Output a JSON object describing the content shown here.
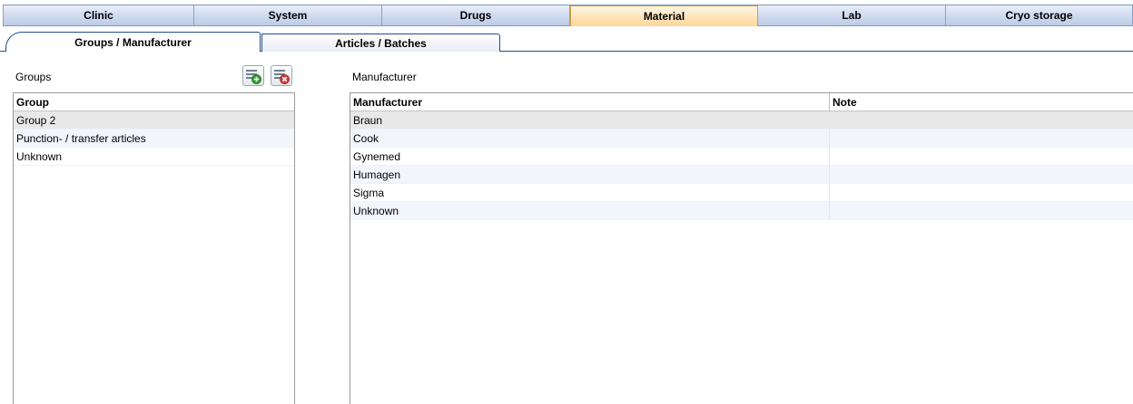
{
  "top_tabs": [
    {
      "label": "Clinic",
      "active": false
    },
    {
      "label": "System",
      "active": false
    },
    {
      "label": "Drugs",
      "active": false
    },
    {
      "label": "Material",
      "active": true
    },
    {
      "label": "Lab",
      "active": false
    },
    {
      "label": "Cryo storage",
      "active": false
    }
  ],
  "sub_tabs": [
    {
      "label": "Groups / Manufacturer",
      "active": true
    },
    {
      "label": "Articles / Batches",
      "active": false
    }
  ],
  "groups_panel": {
    "title": "Groups",
    "add_icon": "add-list-icon",
    "delete_icon": "delete-list-icon",
    "column": "Group",
    "rows": [
      "Group 2",
      "Punction- / transfer articles",
      "Unknown"
    ]
  },
  "manufacturer_panel": {
    "title": "Manufacturer",
    "columns": [
      "Manufacturer",
      "Note"
    ],
    "rows": [
      {
        "manufacturer": "Braun",
        "note": ""
      },
      {
        "manufacturer": "Cook",
        "note": ""
      },
      {
        "manufacturer": "Gynemed",
        "note": ""
      },
      {
        "manufacturer": "Humagen",
        "note": ""
      },
      {
        "manufacturer": "Sigma",
        "note": ""
      },
      {
        "manufacturer": "Unknown",
        "note": ""
      }
    ]
  },
  "colors": {
    "active_tab": "#ffd69a",
    "tab": "#cfdaee",
    "row_alt": "#f2f5fc",
    "row_selected": "#e8e8e8"
  }
}
